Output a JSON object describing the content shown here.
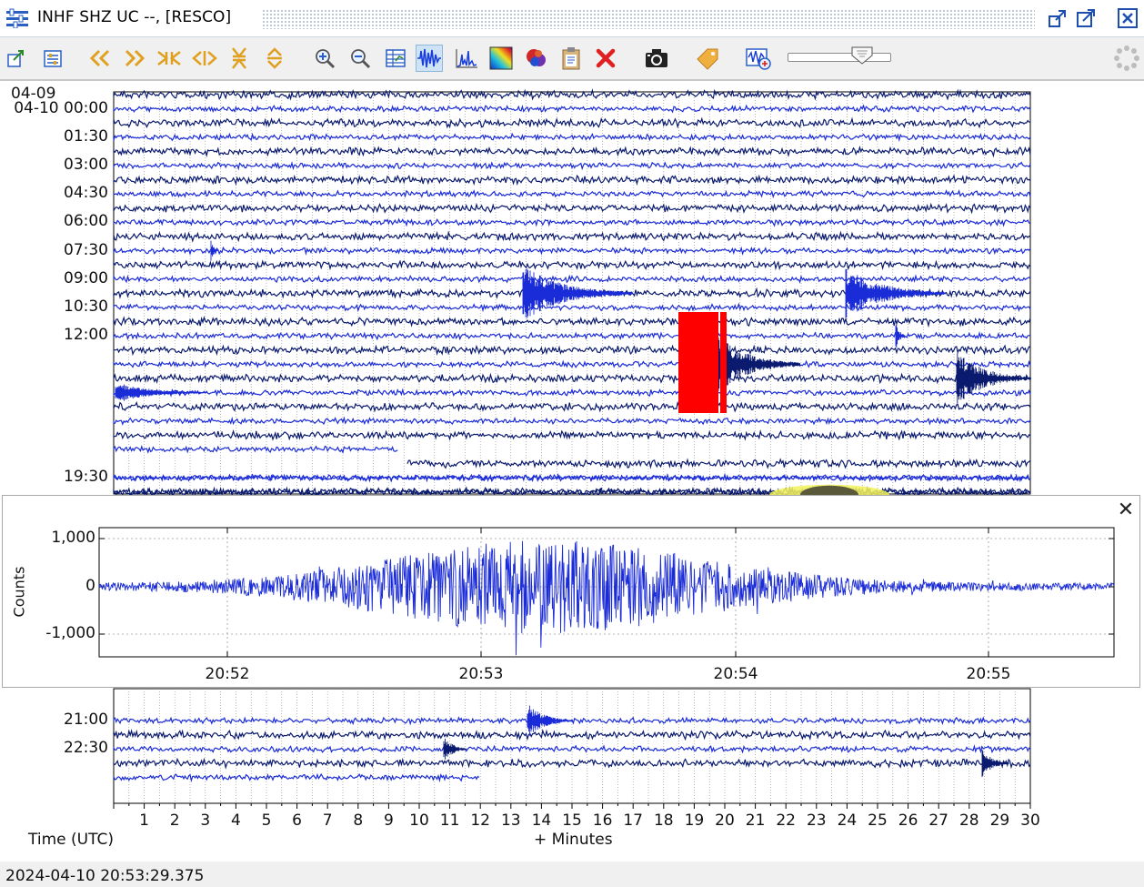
{
  "window": {
    "title": "INHF SHZ UC --, [RESCO]",
    "buttons": [
      "undock-icon",
      "popout-icon",
      "close-icon"
    ]
  },
  "toolbar": {
    "items": [
      "export-icon",
      "settings-icon",
      "scroll-back-fast-icon",
      "scroll-forward-fast-icon",
      "compress-horizontal-icon",
      "expand-horizontal-icon",
      "compress-vertical-icon",
      "expand-vertical-icon",
      "zoom-in-icon",
      "zoom-out-icon",
      "table-icon",
      "waveform-icon",
      "spectrum-icon",
      "spectrogram-icon",
      "particle-motion-icon",
      "clipboard-icon",
      "remove-icon",
      "camera-icon",
      "tag-icon",
      "filter-icon"
    ],
    "active": "waveform-icon",
    "slider_level": 0.7
  },
  "helicorder": {
    "row_labels": [
      {
        "text": "04-09",
        "row": 0,
        "align": "left"
      },
      {
        "text": "04-10 00:00",
        "row": 1,
        "align": "right"
      },
      {
        "text": "01:30",
        "row": 3,
        "align": "right"
      },
      {
        "text": "03:00",
        "row": 5,
        "align": "right"
      },
      {
        "text": "04:30",
        "row": 7,
        "align": "right"
      },
      {
        "text": "06:00",
        "row": 9,
        "align": "right"
      },
      {
        "text": "07:30",
        "row": 11,
        "align": "right"
      },
      {
        "text": "09:00",
        "row": 13,
        "align": "right"
      },
      {
        "text": "10:30",
        "row": 15,
        "align": "right"
      },
      {
        "text": "12:00",
        "row": 17,
        "align": "right"
      },
      {
        "text": "19:30",
        "row": 27,
        "align": "right"
      },
      {
        "text": "21:00",
        "row": 29,
        "align": "right"
      },
      {
        "text": "22:30",
        "row": 31,
        "align": "right"
      }
    ],
    "x_ticks": [
      "1",
      "2",
      "3",
      "4",
      "5",
      "6",
      "7",
      "8",
      "9",
      "10",
      "11",
      "12",
      "13",
      "14",
      "15",
      "16",
      "17",
      "18",
      "19",
      "20",
      "21",
      "22",
      "23",
      "24",
      "25",
      "26",
      "27",
      "28",
      "29",
      "30"
    ],
    "x_label": "+ Minutes",
    "time_label": "Time (UTC)",
    "colors": {
      "trace_dark": "#0a1a6e",
      "trace_blue": "#1a2bd8",
      "highlight_red": "#ff0000",
      "highlight_yellow": "#f2f25a"
    }
  },
  "zoom_panel": {
    "y_axis_label": "Counts",
    "y_ticks": [
      "1,000",
      "0",
      "-1,000"
    ],
    "x_ticks": [
      "20:52",
      "20:53",
      "20:54",
      "20:55"
    ],
    "close_symbol": "✕"
  },
  "status": {
    "cursor_time": "2024-04-10 20:53:29.375"
  }
}
